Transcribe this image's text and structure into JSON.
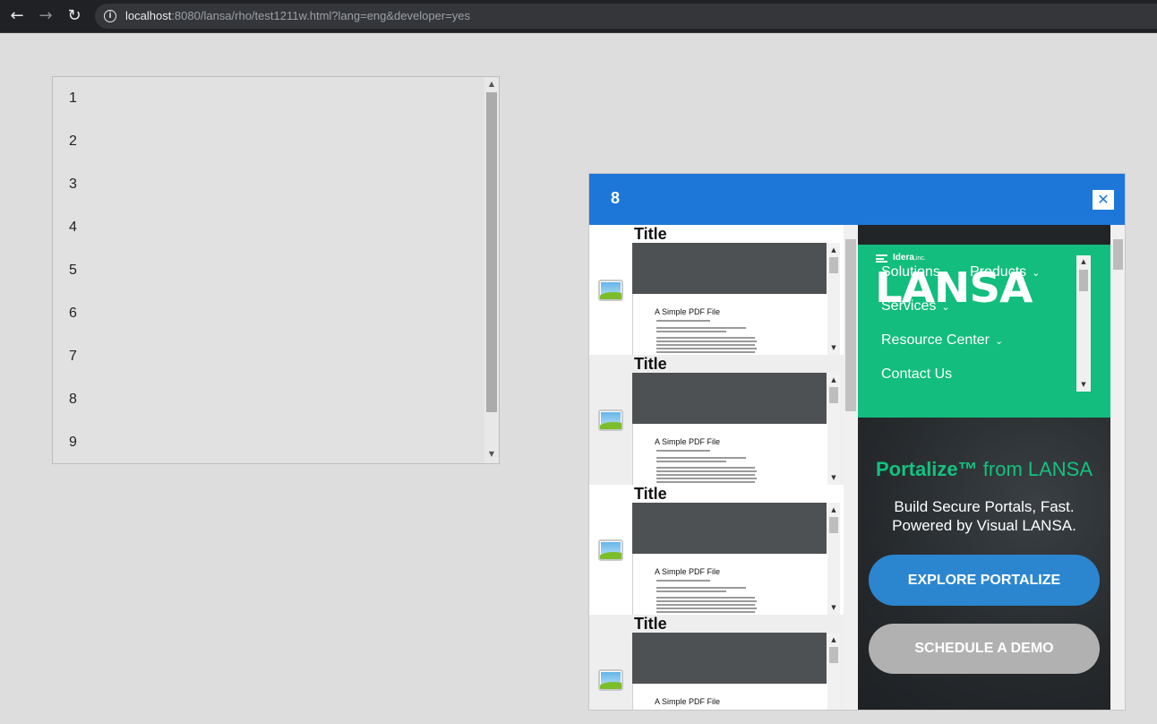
{
  "browser": {
    "url_host": "localhost",
    "url_rest": ":8080/lansa/rho/test1211w.html?lang=eng&developer=yes"
  },
  "list": {
    "items": [
      "1",
      "2",
      "3",
      "4",
      "5",
      "6",
      "7",
      "8",
      "9"
    ]
  },
  "dialog": {
    "title": "8",
    "close_glyph": "✕",
    "cards": [
      {
        "title": "Title",
        "pdf_heading": "A Simple PDF File"
      },
      {
        "title": "Title",
        "pdf_heading": "A Simple PDF File"
      },
      {
        "title": "Title",
        "pdf_heading": "A Simple PDF File"
      },
      {
        "title": "Title",
        "pdf_heading": "A Simple PDF File"
      }
    ],
    "site": {
      "brand_company": "Idera",
      "brand_suffix": ",inc.",
      "logo": "LANSA",
      "logo_mark": "®",
      "nav": {
        "solutions": "Solutions",
        "products": "Products",
        "services": "Services",
        "resource_center": "Resource Center",
        "contact_us": "Contact Us"
      },
      "hero": {
        "title_product": "Portalize™",
        "title_rest": " from LANSA",
        "line1": "Build Secure Portals, Fast.",
        "line2": "Powered by Visual LANSA.",
        "explore_button": "EXPLORE PORTALIZE",
        "demo_button": "SCHEDULE A DEMO"
      }
    }
  },
  "colors": {
    "dialog_header": "#1d77d8",
    "brand_green": "#12bd7d",
    "explore_blue": "#2b86cf"
  }
}
